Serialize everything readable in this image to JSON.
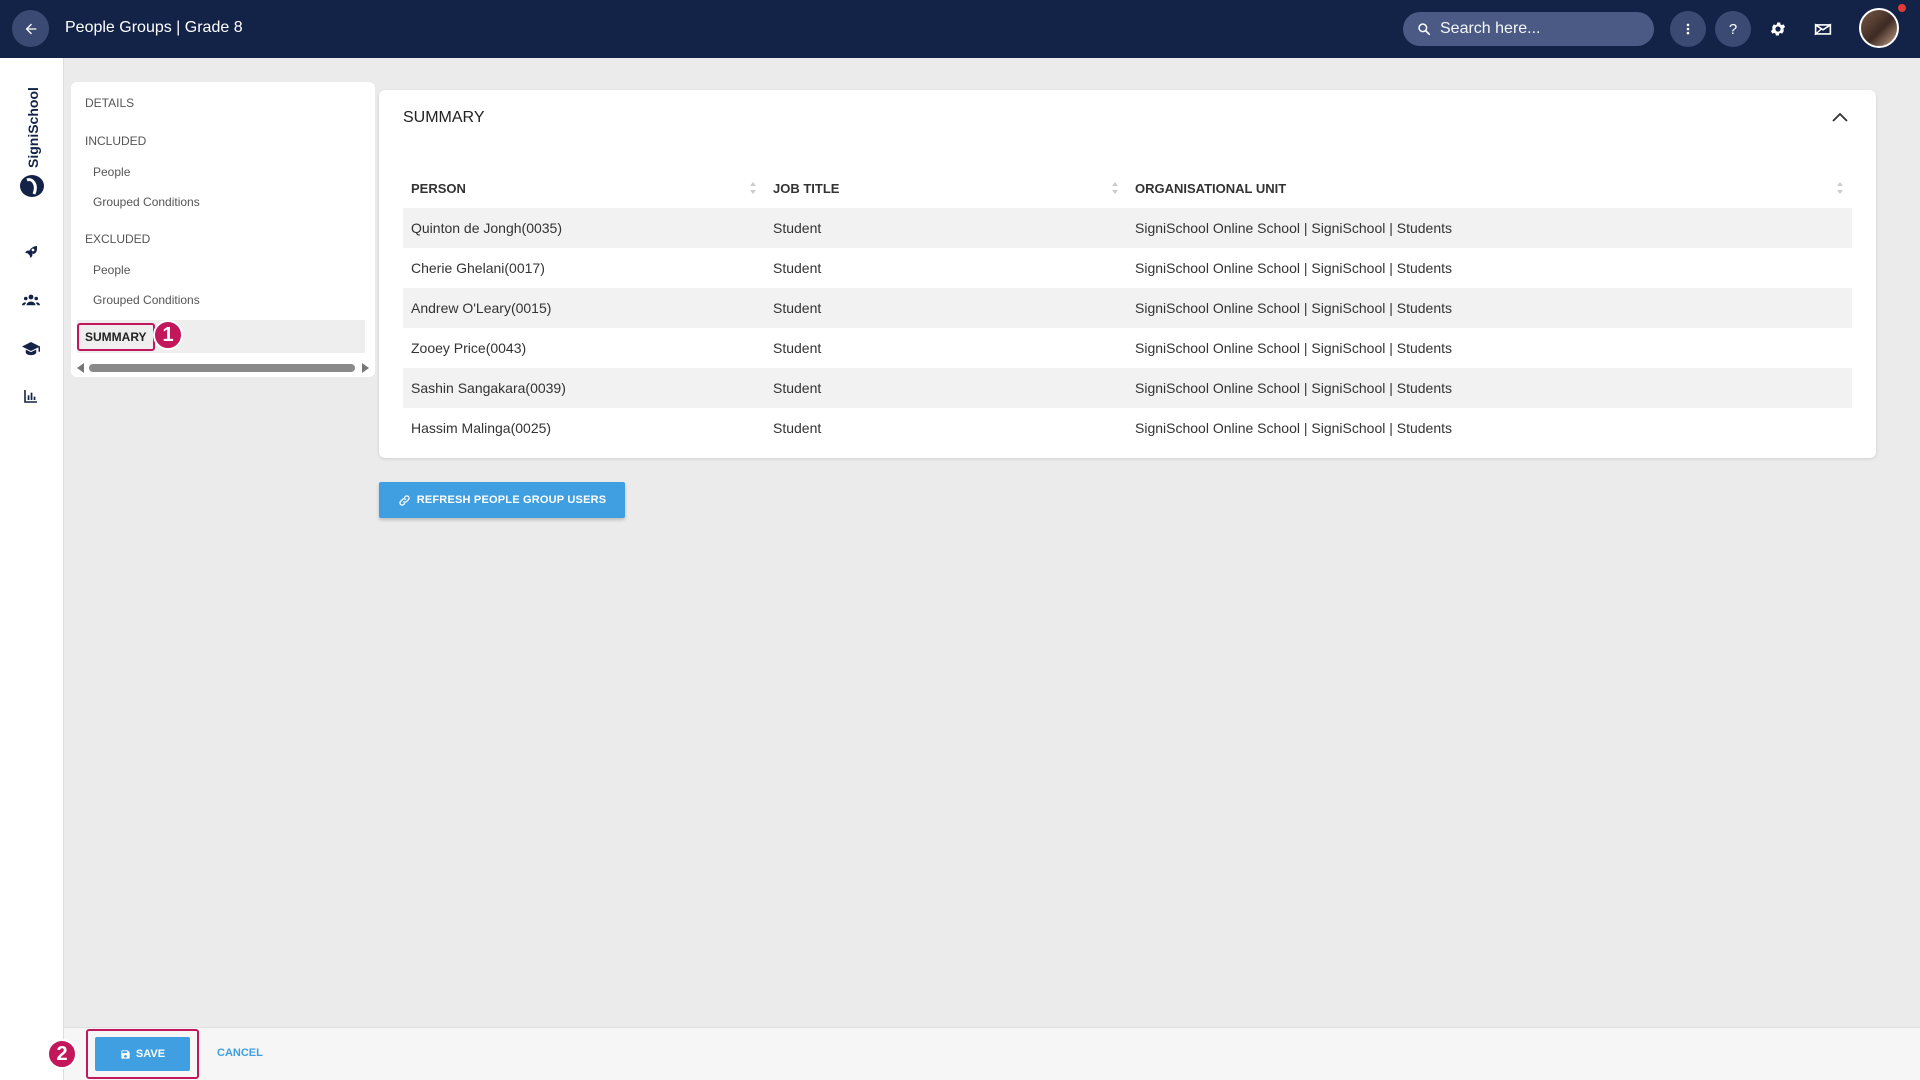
{
  "header": {
    "title": "People Groups | Grade 8",
    "search_placeholder": "Search here...",
    "icons": [
      "arrow-left-icon",
      "search-icon",
      "more-vertical-icon",
      "help-icon",
      "gear-icon",
      "messages-icon",
      "avatar"
    ]
  },
  "sidebar": {
    "logo_text": "SigniSchool",
    "icons": [
      "rocket-icon",
      "people-icon",
      "graduation-cap-icon",
      "bar-chart-icon"
    ]
  },
  "section_nav": {
    "details": "DETAILS",
    "included": "INCLUDED",
    "included_people": "People",
    "included_grouped": "Grouped Conditions",
    "excluded": "EXCLUDED",
    "excluded_people": "People",
    "excluded_grouped": "Grouped Conditions",
    "summary": "SUMMARY"
  },
  "summary": {
    "title": "SUMMARY",
    "columns": [
      "PERSON",
      "JOB TITLE",
      "ORGANISATIONAL UNIT"
    ],
    "rows": [
      {
        "person": "Quinton de Jongh(0035)",
        "job_title": "Student",
        "org_unit": "SigniSchool Online School | SigniSchool | Students"
      },
      {
        "person": "Cherie Ghelani(0017)",
        "job_title": "Student",
        "org_unit": "SigniSchool Online School | SigniSchool | Students"
      },
      {
        "person": "Andrew O'Leary(0015)",
        "job_title": "Student",
        "org_unit": "SigniSchool Online School | SigniSchool | Students"
      },
      {
        "person": "Zooey Price(0043)",
        "job_title": "Student",
        "org_unit": "SigniSchool Online School | SigniSchool | Students"
      },
      {
        "person": "Sashin Sangakara(0039)",
        "job_title": "Student",
        "org_unit": "SigniSchool Online School | SigniSchool | Students"
      },
      {
        "person": "Hassim Malinga(0025)",
        "job_title": "Student",
        "org_unit": "SigniSchool Online School | SigniSchool | Students"
      }
    ]
  },
  "actions": {
    "refresh_label": "REFRESH PEOPLE GROUP USERS",
    "save_label": "SAVE",
    "cancel_label": "CANCEL"
  },
  "annotations": {
    "step1": "1",
    "step2": "2"
  },
  "colors": {
    "header_bg": "#132347",
    "accent": "#3f9fe0",
    "highlight": "#c2185b"
  }
}
